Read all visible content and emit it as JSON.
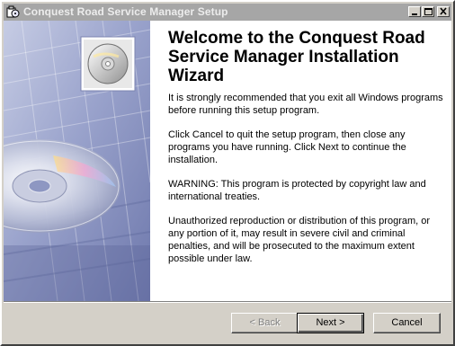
{
  "window": {
    "title": "Conquest Road Service Manager Setup",
    "app_icon": "setup-installer-icon",
    "controls": {
      "minimize_icon": "minimize-icon",
      "maximize_icon": "maximize-icon",
      "close_icon": "close-icon"
    }
  },
  "side_panel": {
    "image": "cd-disc-artwork"
  },
  "main": {
    "title": "Welcome to the Conquest Road Service Manager Installation Wizard",
    "paragraphs": [
      "It is strongly recommended that you exit all Windows programs before running this setup program.",
      "Click Cancel to quit the setup program, then close any programs you have running.  Click Next to continue the installation.",
      "WARNING: This program is protected by copyright law and international treaties.",
      "Unauthorized reproduction or distribution of this program, or any portion of it, may result in severe civil and criminal penalties, and will be prosecuted to the maximum extent possible under law."
    ]
  },
  "buttons": {
    "back": "< Back",
    "next": "Next >",
    "cancel": "Cancel"
  },
  "colors": {
    "window_face": "#d4d0c8",
    "titlebar_inactive": "#a6a6a6",
    "side_panel_blue": "#8f98c4"
  }
}
